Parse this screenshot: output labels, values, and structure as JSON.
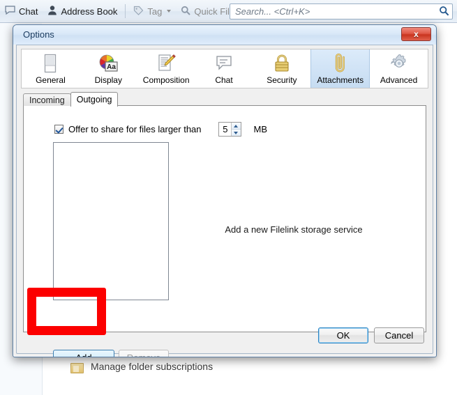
{
  "background": {
    "toolbar": {
      "items": [
        {
          "label": "Chat",
          "icon": "chat-bubble-icon",
          "dim": false,
          "caret": false
        },
        {
          "label": "Address Book",
          "icon": "address-book-icon",
          "dim": false,
          "caret": false
        },
        {
          "label": "Tag",
          "icon": "tag-icon",
          "dim": true,
          "caret": true
        },
        {
          "label": "Quick Filter",
          "icon": "magnifier-icon",
          "dim": true,
          "caret": false
        }
      ],
      "search": {
        "placeholder": "Search... <Ctrl+K>",
        "icon": "search-icon"
      }
    },
    "rows": [
      {
        "label": "Manage folder subscriptions",
        "icon": "folder-icon"
      }
    ]
  },
  "dialog": {
    "title": "Options",
    "close_label": "x",
    "panes": [
      {
        "label": "General",
        "icon": "general-window-icon",
        "selected": false
      },
      {
        "label": "Display",
        "icon": "display-colorwheel-icon",
        "selected": false
      },
      {
        "label": "Composition",
        "icon": "composition-pencil-icon",
        "selected": false
      },
      {
        "label": "Chat",
        "icon": "chat-bubble-icon",
        "selected": false
      },
      {
        "label": "Security",
        "icon": "security-padlock-icon",
        "selected": false
      },
      {
        "label": "Attachments",
        "icon": "attachments-paperclip-icon",
        "selected": true
      },
      {
        "label": "Advanced",
        "icon": "advanced-gear-icon",
        "selected": false
      }
    ],
    "tabs": [
      {
        "label": "Incoming",
        "active": false
      },
      {
        "label": "Outgoing",
        "active": true
      }
    ],
    "outgoing": {
      "offer_checkbox": {
        "label": "Offer to share for files larger than",
        "checked": true
      },
      "size_value": "5",
      "size_unit": "MB",
      "hint": "Add a new Filelink storage service",
      "services": []
    },
    "buttons": {
      "add": {
        "label": "Add",
        "accesskey": "A",
        "enabled": true,
        "highlighted": true
      },
      "remove": {
        "label": "Remove",
        "accesskey": "R",
        "enabled": false
      },
      "ok": {
        "label": "OK",
        "default": true
      },
      "cancel": {
        "label": "Cancel",
        "default": false
      }
    }
  },
  "annotation": {
    "color": "#fc0000",
    "target": "Add"
  }
}
